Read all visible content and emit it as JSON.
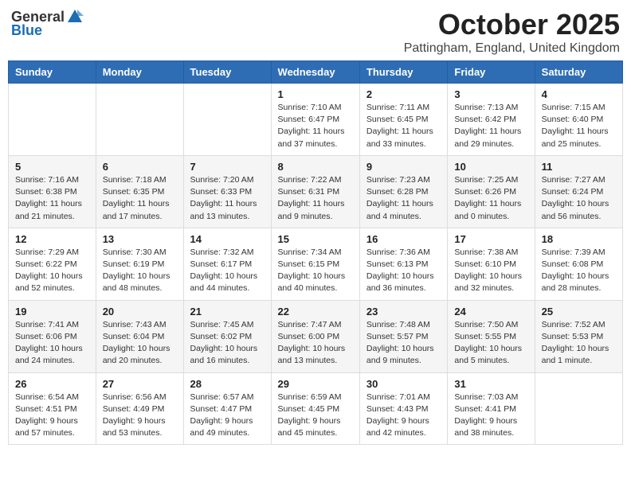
{
  "header": {
    "logo_general": "General",
    "logo_blue": "Blue",
    "month": "October 2025",
    "location": "Pattingham, England, United Kingdom"
  },
  "days_of_week": [
    "Sunday",
    "Monday",
    "Tuesday",
    "Wednesday",
    "Thursday",
    "Friday",
    "Saturday"
  ],
  "weeks": [
    [
      {
        "day": "",
        "text": ""
      },
      {
        "day": "",
        "text": ""
      },
      {
        "day": "",
        "text": ""
      },
      {
        "day": "1",
        "text": "Sunrise: 7:10 AM\nSunset: 6:47 PM\nDaylight: 11 hours and 37 minutes."
      },
      {
        "day": "2",
        "text": "Sunrise: 7:11 AM\nSunset: 6:45 PM\nDaylight: 11 hours and 33 minutes."
      },
      {
        "day": "3",
        "text": "Sunrise: 7:13 AM\nSunset: 6:42 PM\nDaylight: 11 hours and 29 minutes."
      },
      {
        "day": "4",
        "text": "Sunrise: 7:15 AM\nSunset: 6:40 PM\nDaylight: 11 hours and 25 minutes."
      }
    ],
    [
      {
        "day": "5",
        "text": "Sunrise: 7:16 AM\nSunset: 6:38 PM\nDaylight: 11 hours and 21 minutes."
      },
      {
        "day": "6",
        "text": "Sunrise: 7:18 AM\nSunset: 6:35 PM\nDaylight: 11 hours and 17 minutes."
      },
      {
        "day": "7",
        "text": "Sunrise: 7:20 AM\nSunset: 6:33 PM\nDaylight: 11 hours and 13 minutes."
      },
      {
        "day": "8",
        "text": "Sunrise: 7:22 AM\nSunset: 6:31 PM\nDaylight: 11 hours and 9 minutes."
      },
      {
        "day": "9",
        "text": "Sunrise: 7:23 AM\nSunset: 6:28 PM\nDaylight: 11 hours and 4 minutes."
      },
      {
        "day": "10",
        "text": "Sunrise: 7:25 AM\nSunset: 6:26 PM\nDaylight: 11 hours and 0 minutes."
      },
      {
        "day": "11",
        "text": "Sunrise: 7:27 AM\nSunset: 6:24 PM\nDaylight: 10 hours and 56 minutes."
      }
    ],
    [
      {
        "day": "12",
        "text": "Sunrise: 7:29 AM\nSunset: 6:22 PM\nDaylight: 10 hours and 52 minutes."
      },
      {
        "day": "13",
        "text": "Sunrise: 7:30 AM\nSunset: 6:19 PM\nDaylight: 10 hours and 48 minutes."
      },
      {
        "day": "14",
        "text": "Sunrise: 7:32 AM\nSunset: 6:17 PM\nDaylight: 10 hours and 44 minutes."
      },
      {
        "day": "15",
        "text": "Sunrise: 7:34 AM\nSunset: 6:15 PM\nDaylight: 10 hours and 40 minutes."
      },
      {
        "day": "16",
        "text": "Sunrise: 7:36 AM\nSunset: 6:13 PM\nDaylight: 10 hours and 36 minutes."
      },
      {
        "day": "17",
        "text": "Sunrise: 7:38 AM\nSunset: 6:10 PM\nDaylight: 10 hours and 32 minutes."
      },
      {
        "day": "18",
        "text": "Sunrise: 7:39 AM\nSunset: 6:08 PM\nDaylight: 10 hours and 28 minutes."
      }
    ],
    [
      {
        "day": "19",
        "text": "Sunrise: 7:41 AM\nSunset: 6:06 PM\nDaylight: 10 hours and 24 minutes."
      },
      {
        "day": "20",
        "text": "Sunrise: 7:43 AM\nSunset: 6:04 PM\nDaylight: 10 hours and 20 minutes."
      },
      {
        "day": "21",
        "text": "Sunrise: 7:45 AM\nSunset: 6:02 PM\nDaylight: 10 hours and 16 minutes."
      },
      {
        "day": "22",
        "text": "Sunrise: 7:47 AM\nSunset: 6:00 PM\nDaylight: 10 hours and 13 minutes."
      },
      {
        "day": "23",
        "text": "Sunrise: 7:48 AM\nSunset: 5:57 PM\nDaylight: 10 hours and 9 minutes."
      },
      {
        "day": "24",
        "text": "Sunrise: 7:50 AM\nSunset: 5:55 PM\nDaylight: 10 hours and 5 minutes."
      },
      {
        "day": "25",
        "text": "Sunrise: 7:52 AM\nSunset: 5:53 PM\nDaylight: 10 hours and 1 minute."
      }
    ],
    [
      {
        "day": "26",
        "text": "Sunrise: 6:54 AM\nSunset: 4:51 PM\nDaylight: 9 hours and 57 minutes."
      },
      {
        "day": "27",
        "text": "Sunrise: 6:56 AM\nSunset: 4:49 PM\nDaylight: 9 hours and 53 minutes."
      },
      {
        "day": "28",
        "text": "Sunrise: 6:57 AM\nSunset: 4:47 PM\nDaylight: 9 hours and 49 minutes."
      },
      {
        "day": "29",
        "text": "Sunrise: 6:59 AM\nSunset: 4:45 PM\nDaylight: 9 hours and 45 minutes."
      },
      {
        "day": "30",
        "text": "Sunrise: 7:01 AM\nSunset: 4:43 PM\nDaylight: 9 hours and 42 minutes."
      },
      {
        "day": "31",
        "text": "Sunrise: 7:03 AM\nSunset: 4:41 PM\nDaylight: 9 hours and 38 minutes."
      },
      {
        "day": "",
        "text": ""
      }
    ]
  ]
}
